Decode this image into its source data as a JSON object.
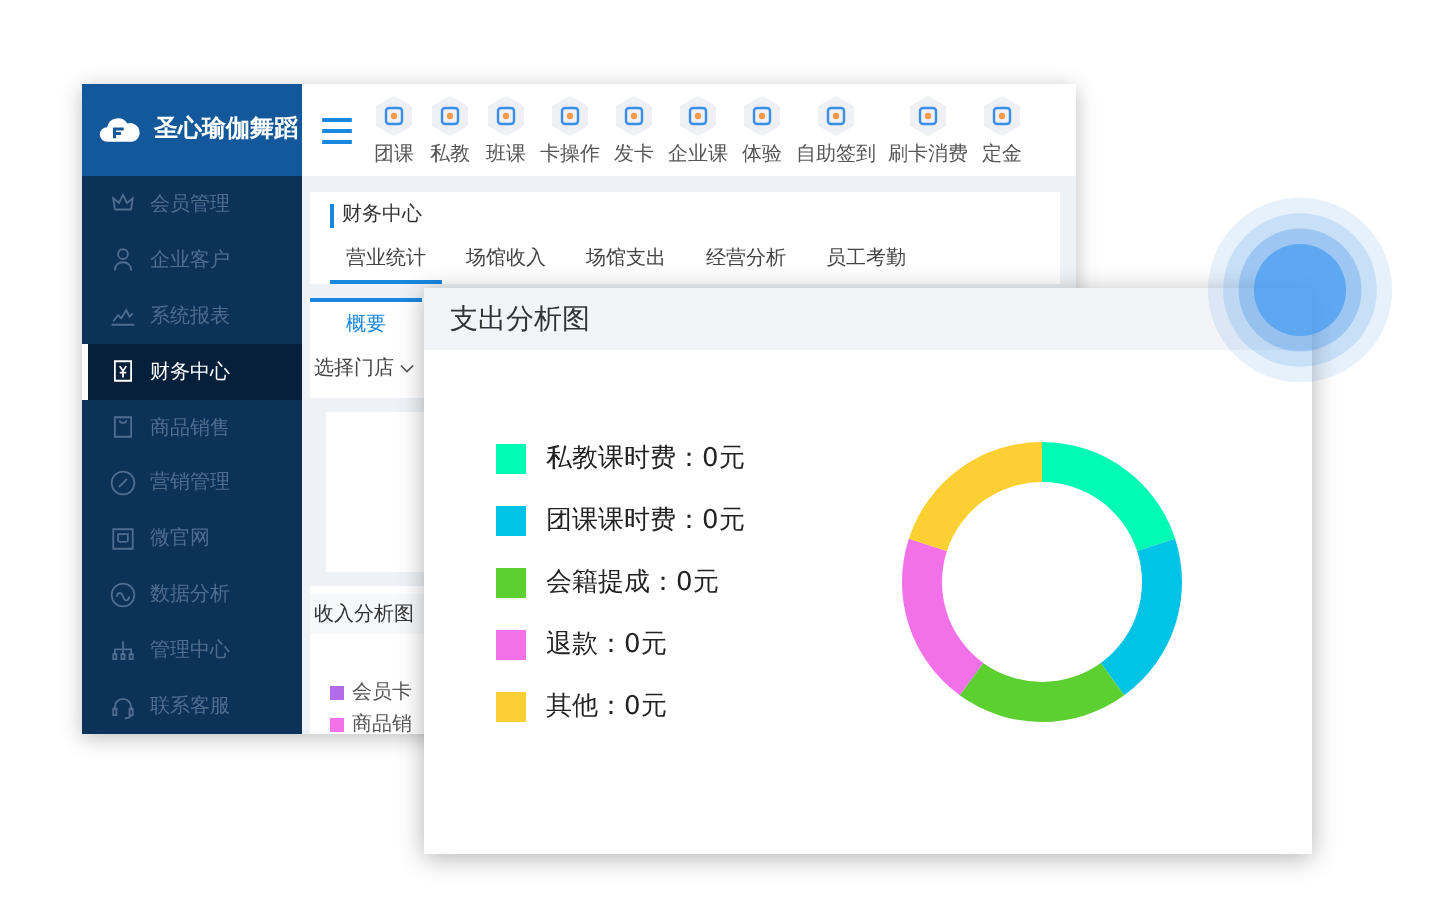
{
  "app": {
    "brand": "圣心瑜伽舞蹈",
    "sidebar": {
      "items": [
        {
          "label": "会员管理",
          "selected": false
        },
        {
          "label": "企业客户",
          "selected": false
        },
        {
          "label": "系统报表",
          "selected": false
        },
        {
          "label": "财务中心",
          "selected": true
        },
        {
          "label": "商品销售",
          "selected": false
        },
        {
          "label": "营销管理",
          "selected": false
        },
        {
          "label": "微官网",
          "selected": false
        },
        {
          "label": "数据分析",
          "selected": false
        },
        {
          "label": "管理中心",
          "selected": false
        },
        {
          "label": "联系客服",
          "selected": false
        }
      ]
    },
    "toolbar": [
      "团课",
      "私教",
      "班课",
      "卡操作",
      "发卡",
      "企业课",
      "体验",
      "自助签到",
      "刷卡消费",
      "定金"
    ],
    "section_title": "财务中心",
    "tabs": [
      {
        "label": "营业统计",
        "selected": true
      },
      {
        "label": "场馆收入",
        "selected": false
      },
      {
        "label": "场馆支出",
        "selected": false
      },
      {
        "label": "经营分析",
        "selected": false
      },
      {
        "label": "员工考勤",
        "selected": false
      }
    ],
    "subtabs": [
      {
        "label": "概要",
        "selected": true
      }
    ],
    "store_select": "选择门店",
    "income_chart": {
      "title": "收入分析图",
      "legend": [
        {
          "label": "会员卡",
          "color": "#b36bea"
        },
        {
          "label": "商品销",
          "color": "#f271e8"
        }
      ]
    }
  },
  "popup": {
    "title": "支出分析图",
    "legend": [
      {
        "label": "私教课时费：0元",
        "color": "#00fbb4"
      },
      {
        "label": "团课课时费：0元",
        "color": "#00c3e6"
      },
      {
        "label": "会籍提成：0元",
        "color": "#5ccf31"
      },
      {
        "label": "退款：0元",
        "color": "#f271e8"
      },
      {
        "label": "其他：0元",
        "color": "#fccf33"
      }
    ]
  }
}
